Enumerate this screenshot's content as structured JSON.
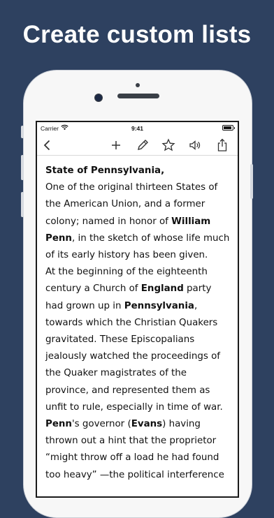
{
  "headline": "Create custom lists",
  "status_bar": {
    "carrier": "Carrier",
    "time": "9:41"
  },
  "toolbar": {
    "back": "chevron-left-icon",
    "add": "plus-icon",
    "edit": "pencil-icon",
    "favorite": "star-icon",
    "speak": "speaker-icon",
    "share": "share-icon"
  },
  "article": {
    "title": "State of Pennsylvania,",
    "lines": [
      [
        {
          "t": "One of the original thirteen States of"
        }
      ],
      [
        {
          "t": "the American Union, and a former"
        }
      ],
      [
        {
          "t": "colony; named in honor of "
        },
        {
          "t": "William",
          "b": true
        }
      ],
      [
        {
          "t": "Penn",
          "b": true
        },
        {
          "t": ", in the sketch of whose life much"
        }
      ],
      [
        {
          "t": "of its early history has been given."
        }
      ],
      [
        {
          "t": "At the beginning of the eighteenth"
        }
      ],
      [
        {
          "t": "century a Church of "
        },
        {
          "t": "England",
          "b": true
        },
        {
          "t": " party"
        }
      ],
      [
        {
          "t": "had grown up in "
        },
        {
          "t": "Pennsylvania",
          "b": true
        },
        {
          "t": ","
        }
      ],
      [
        {
          "t": "towards which the Christian Quakers"
        }
      ],
      [
        {
          "t": "gravitated. These Episcopalians"
        }
      ],
      [
        {
          "t": "jealously watched the proceedings of"
        }
      ],
      [
        {
          "t": "the Quaker magistrates of the"
        }
      ],
      [
        {
          "t": "province, and represented them as"
        }
      ],
      [
        {
          "t": "unfit to rule, especially in time of war."
        }
      ],
      [
        {
          "t": "Penn",
          "b": true
        },
        {
          "t": "'s governor ("
        },
        {
          "t": "Evans",
          "b": true
        },
        {
          "t": ") having"
        }
      ],
      [
        {
          "t": "thrown out a hint that the proprietor"
        }
      ],
      [
        {
          "t": "“might throw off a load he had found"
        }
      ],
      [
        {
          "t": "too heavy” —the political interference"
        }
      ]
    ]
  }
}
